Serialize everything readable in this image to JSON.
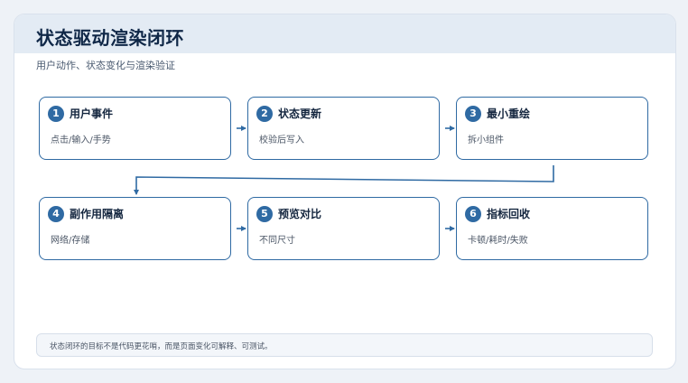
{
  "header": {
    "title": "状态驱动渲染闭环",
    "subtitle": "用户动作、状态变化与渲染验证"
  },
  "steps": [
    {
      "num": "1",
      "title": "用户事件",
      "desc": "点击/输入/手势"
    },
    {
      "num": "2",
      "title": "状态更新",
      "desc": "校验后写入"
    },
    {
      "num": "3",
      "title": "最小重绘",
      "desc": "拆小组件"
    },
    {
      "num": "4",
      "title": "副作用隔离",
      "desc": "网络/存储"
    },
    {
      "num": "5",
      "title": "预览对比",
      "desc": "不同尺寸"
    },
    {
      "num": "6",
      "title": "指标回收",
      "desc": "卡顿/耗时/失败"
    }
  ],
  "footer": {
    "note": "状态闭环的目标不是代码更花哨，而是页面变化可解释、可测试。"
  },
  "colors": {
    "accent": "#2f6aa3",
    "title": "#0f2747",
    "header_bg": "#e3ebf4"
  }
}
